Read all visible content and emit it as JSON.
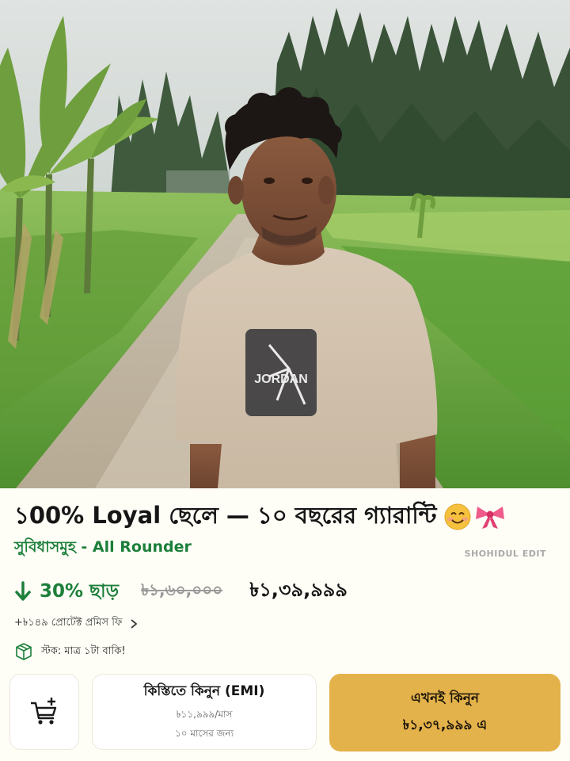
{
  "product": {
    "title": "১00% Loyal ছেলে — ১০ বছরের গ্যারান্টি",
    "title_emojis": [
      "smiling-face-emoji",
      "ribbon-emoji"
    ],
    "subtitle": "সুবিধাসমুহ - All Rounder",
    "watermark": "SHOHIDUL EDIT",
    "image_description_icon": "photo"
  },
  "pricing": {
    "discount_label": "30% ছাড়",
    "old_price": "৳১,৬০,০০০",
    "new_price": "৳১,৩৯,৯৯৯",
    "fee_text": "+৳১৪৯ প্রোটেক্ট প্রমিস ফি",
    "stock_text": "স্টক: মাত্র ১টা বাকি!",
    "discount_color": "#1c7f3a"
  },
  "actions": {
    "cart_icon": "cart-add-icon",
    "emi_label": "কিস্তিতে কিনুন (EMI)",
    "emi_monthly": "৳১১,৯৯৯/মাস",
    "emi_duration": "১০ মাসের জন্য",
    "buy_label": "এখনই কিনুন",
    "buy_price": "৳১,৩৭,৯৯৯ এ",
    "buy_color": "#e4b24a"
  }
}
